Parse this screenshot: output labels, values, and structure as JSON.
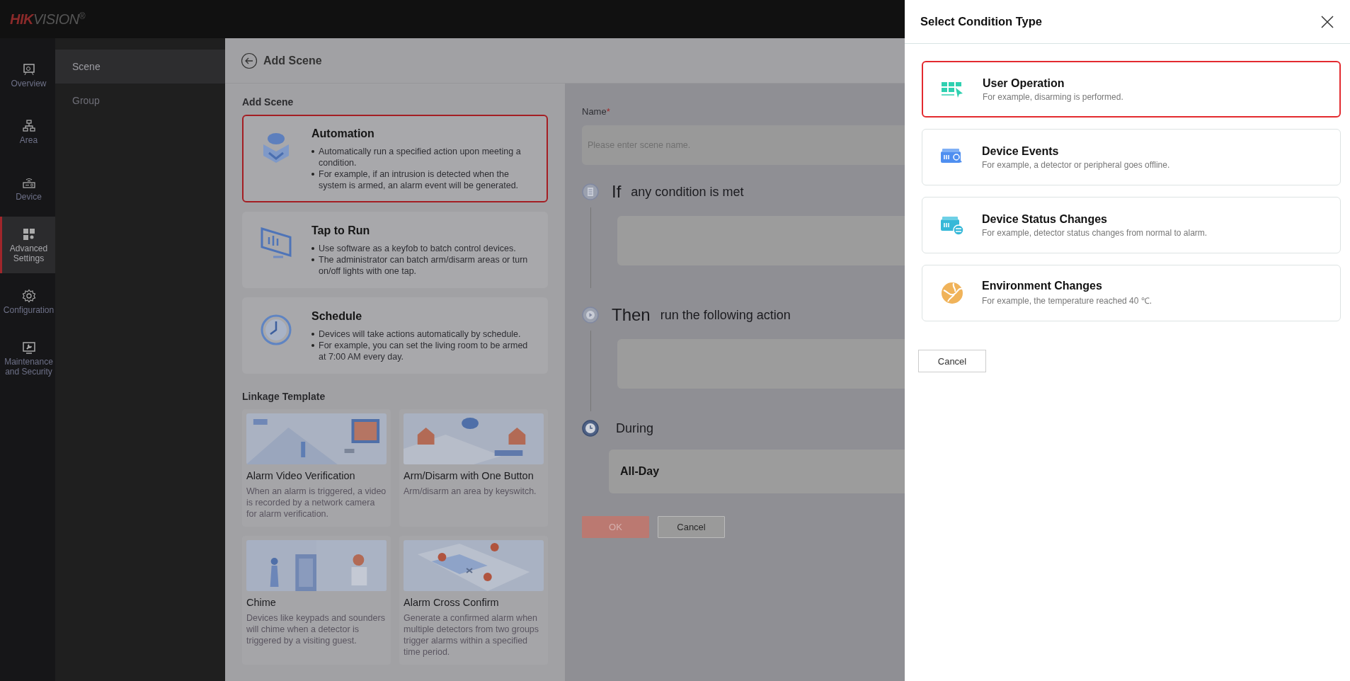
{
  "brand": {
    "logo_red": "HIK",
    "logo_grey": "VISION",
    "mark": "®"
  },
  "nav": {
    "items": [
      {
        "label": "Overview",
        "selected": false
      },
      {
        "label": "Area",
        "selected": false
      },
      {
        "label": "Device",
        "selected": false
      },
      {
        "label": "Advanced Settings",
        "selected": true
      },
      {
        "label": "Configuration",
        "selected": false
      },
      {
        "label": "Maintenance and Security",
        "selected": false
      }
    ]
  },
  "sub_nav": {
    "items": [
      {
        "label": "Scene",
        "selected": true
      },
      {
        "label": "Group",
        "selected": false
      }
    ]
  },
  "page": {
    "title": "Add Scene"
  },
  "add_scene": {
    "heading": "Add Scene",
    "types": [
      {
        "title": "Automation",
        "selected": true,
        "bullets": [
          "Automatically run a specified action upon meeting a condition.",
          "For example, if an intrusion is detected when the system is armed, an alarm event will be generated."
        ]
      },
      {
        "title": "Tap to Run",
        "selected": false,
        "bullets": [
          "Use software as a keyfob to batch control devices.",
          "The administrator can batch arm/disarm areas or turn on/off lights with one tap."
        ]
      },
      {
        "title": "Schedule",
        "selected": false,
        "bullets": [
          "Devices will take actions automatically by schedule.",
          "For example, you can set the living room to be armed at 7:00 AM every day."
        ]
      }
    ]
  },
  "linkage_template": {
    "heading": "Linkage Template",
    "templates": [
      {
        "title": "Alarm Video Verification",
        "description": "When an alarm is triggered, a video is recorded by a network camera for alarm verification."
      },
      {
        "title": "Arm/Disarm with One Button",
        "description": "Arm/disarm an area by keyswitch."
      },
      {
        "title": "Chime",
        "description": "Devices like keypads and sounders will chime when a detector is triggered by a visiting guest."
      },
      {
        "title": "Alarm Cross Confirm",
        "description": "Generate a confirmed alarm when multiple detectors from two groups trigger alarms within a specified time period."
      }
    ]
  },
  "form": {
    "name_label": "Name",
    "required_mark": "*",
    "name_placeholder": "Please enter scene name.",
    "steps": [
      {
        "keyword": "If",
        "text": "any condition is met"
      },
      {
        "keyword": "Then",
        "text": "run the following action"
      }
    ],
    "during": {
      "label": "During",
      "value": "All-Day"
    },
    "buttons": [
      {
        "label": "OK",
        "kind": "primary",
        "disabled": true
      },
      {
        "label": "Cancel",
        "kind": "secondary",
        "disabled": false
      }
    ]
  },
  "drawer": {
    "title": "Select Condition Type",
    "conditions": [
      {
        "title": "User Operation",
        "example": "For example, disarming is performed.",
        "selected": true
      },
      {
        "title": "Device Events",
        "example": "For example, a detector or peripheral goes offline.",
        "selected": false
      },
      {
        "title": "Device Status Changes",
        "example": "For example, detector status changes from normal to alarm.",
        "selected": false
      },
      {
        "title": "Environment Changes",
        "example": "For example, the temperature reached 40 ℃.",
        "selected": false
      }
    ],
    "cancel": "Cancel"
  }
}
